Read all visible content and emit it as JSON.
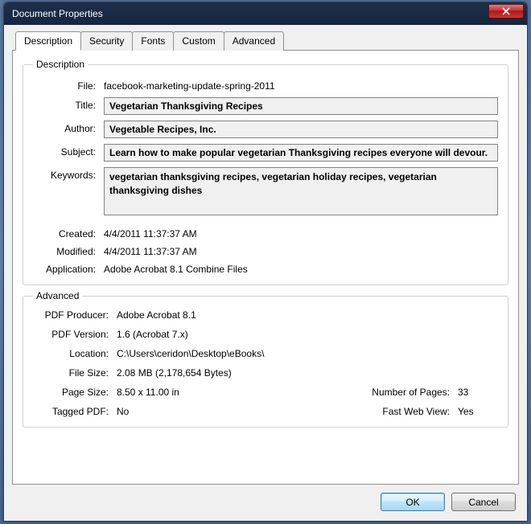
{
  "window": {
    "title": "Document Properties"
  },
  "tabs": [
    "Description",
    "Security",
    "Fonts",
    "Custom",
    "Advanced"
  ],
  "description": {
    "legend": "Description",
    "labels": {
      "file": "File:",
      "title": "Title:",
      "author": "Author:",
      "subject": "Subject:",
      "keywords": "Keywords:",
      "created": "Created:",
      "modified": "Modified:",
      "application": "Application:"
    },
    "file": "facebook-marketing-update-spring-2011",
    "title": "Vegetarian Thanksgiving Recipes",
    "author": "Vegetable Recipes, Inc.",
    "subject": "Learn how to make popular vegetarian Thanksgiving recipes everyone will devour.",
    "keywords": "vegetarian thanksgiving recipes, vegetarian holiday recipes, vegetarian thanksgiving dishes",
    "created": "4/4/2011 11:37:37 AM",
    "modified": "4/4/2011 11:37:37 AM",
    "application": "Adobe Acrobat 8.1 Combine Files"
  },
  "advanced": {
    "legend": "Advanced",
    "labels": {
      "pdf_producer": "PDF Producer:",
      "pdf_version": "PDF Version:",
      "location": "Location:",
      "file_size": "File Size:",
      "page_size": "Page Size:",
      "num_pages": "Number of Pages:",
      "tagged_pdf": "Tagged PDF:",
      "fast_web": "Fast Web View:"
    },
    "pdf_producer": "Adobe Acrobat 8.1",
    "pdf_version": "1.6 (Acrobat 7.x)",
    "location": "C:\\Users\\ceridon\\Desktop\\eBooks\\",
    "file_size": "2.08 MB (2,178,654 Bytes)",
    "page_size": "8.50 x 11.00 in",
    "num_pages": "33",
    "tagged_pdf": "No",
    "fast_web": "Yes"
  },
  "buttons": {
    "ok": "OK",
    "cancel": "Cancel"
  }
}
